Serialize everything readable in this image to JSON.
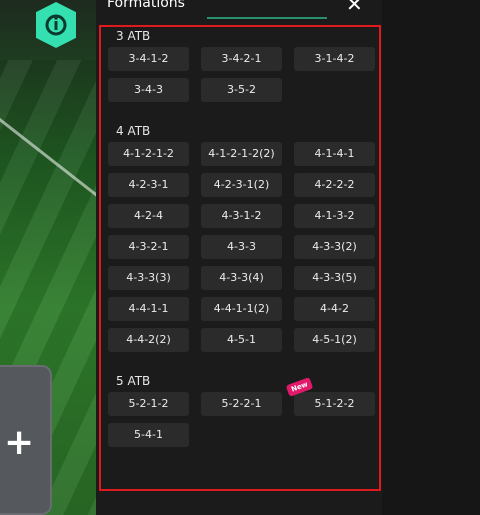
{
  "header": {
    "title": "Formations",
    "close_symbol": "✕"
  },
  "groups": [
    {
      "label": "3 ATB",
      "formations": [
        "3-4-1-2",
        "3-4-2-1",
        "3-1-4-2",
        "3-4-3",
        "3-5-2"
      ]
    },
    {
      "label": "4 ATB",
      "formations": [
        "4-1-2-1-2",
        "4-1-2-1-2(2)",
        "4-1-4-1",
        "4-2-3-1",
        "4-2-3-1(2)",
        "4-2-2-2",
        "4-2-4",
        "4-3-1-2",
        "4-1-3-2",
        "4-3-2-1",
        "4-3-3",
        "4-3-3(2)",
        "4-3-3(3)",
        "4-3-3(4)",
        "4-3-3(5)",
        "4-4-1-1",
        "4-4-1-1(2)",
        "4-4-2",
        "4-4-2(2)",
        "4-5-1",
        "4-5-1(2)"
      ]
    },
    {
      "label": "5 ATB",
      "formations": [
        "5-2-1-2",
        "5-2-2-1",
        "5-1-2-2",
        "5-4-1"
      ]
    }
  ],
  "new_badge": "New",
  "background": {
    "card_plus_symbol": "+",
    "accent_color": "#35e0b0",
    "highlight_border_color": "#e0191f"
  }
}
